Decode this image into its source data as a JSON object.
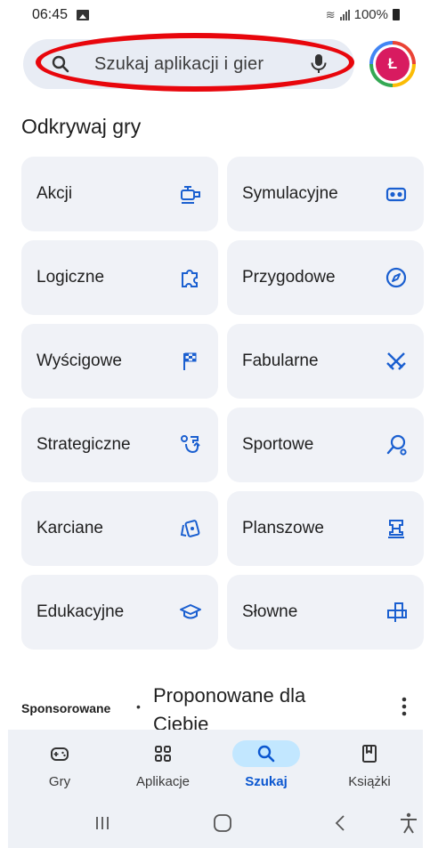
{
  "status_bar": {
    "time": "06:45",
    "battery_text": "100%"
  },
  "search": {
    "placeholder": "Szukaj aplikacji i gier",
    "avatar_letter": "Ł"
  },
  "section": {
    "title": "Odkrywaj gry"
  },
  "categories": [
    {
      "label": "Akcji",
      "icon": "action-game-icon"
    },
    {
      "label": "Symulacyjne",
      "icon": "vr-headset-icon"
    },
    {
      "label": "Logiczne",
      "icon": "puzzle-icon"
    },
    {
      "label": "Przygodowe",
      "icon": "compass-icon"
    },
    {
      "label": "Wyścigowe",
      "icon": "checkered-flag-icon"
    },
    {
      "label": "Fabularne",
      "icon": "crossed-swords-icon"
    },
    {
      "label": "Strategiczne",
      "icon": "strategy-icon"
    },
    {
      "label": "Sportowe",
      "icon": "sports-racket-icon"
    },
    {
      "label": "Karciane",
      "icon": "playing-cards-icon"
    },
    {
      "label": "Planszowe",
      "icon": "chess-rook-icon"
    },
    {
      "label": "Edukacyjne",
      "icon": "graduation-cap-icon"
    },
    {
      "label": "Słowne",
      "icon": "word-tiles-icon"
    }
  ],
  "sponsored": {
    "label": "Sponsorowane",
    "separator": "•",
    "title": "Proponowane dla Ciebie"
  },
  "bottom_nav": [
    {
      "label": "Gry",
      "icon": "gamepad-icon",
      "active": false
    },
    {
      "label": "Aplikacje",
      "icon": "apps-grid-icon",
      "active": false
    },
    {
      "label": "Szukaj",
      "icon": "search-icon",
      "active": true
    },
    {
      "label": "Książki",
      "icon": "bookmark-book-icon",
      "active": false
    }
  ],
  "colors": {
    "accent": "#0b57d0",
    "icon_blue": "#1a5fd0",
    "annotation_red": "#e8060c",
    "avatar_bg": "#d81b60",
    "active_pill": "#c2e7ff"
  }
}
